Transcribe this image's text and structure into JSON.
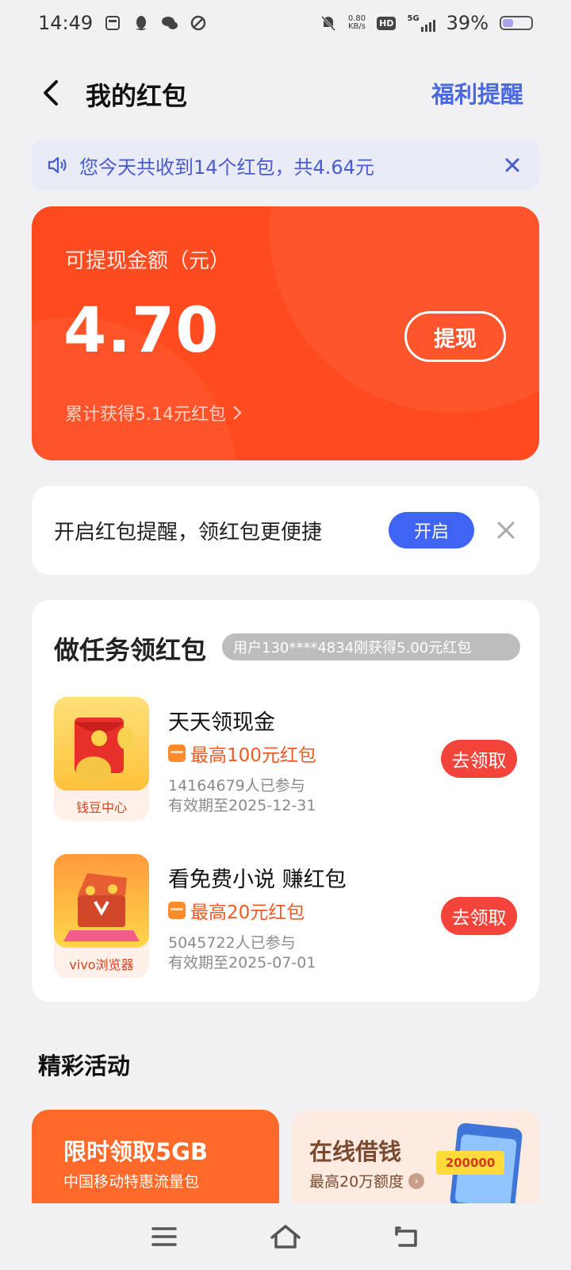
{
  "status_bar": {
    "time": "14:49",
    "speed_value": "0.80",
    "speed_unit": "KB/s",
    "hd_label": "HD",
    "network_label": "5G",
    "battery_text": "39%",
    "battery_level": 0.39
  },
  "header": {
    "title": "我的红包",
    "right_link": "福利提醒"
  },
  "notice": {
    "text": "您今天共收到14个红包，共4.64元"
  },
  "balance": {
    "label": "可提现金额（元）",
    "amount": "4.70",
    "withdraw_label": "提现",
    "total_text": "累计获得5.14元红包"
  },
  "reminder": {
    "text": "开启红包提醒，领红包更便捷",
    "button_label": "开启"
  },
  "tasks": {
    "title": "做任务领红包",
    "marquee": "用户130****4834刚获得5.00元红包",
    "items": [
      {
        "thumb_label": "钱豆中心",
        "name": "天天领现金",
        "reward": "最高100元红包",
        "participants": "14164679人已参与",
        "validity": "有效期至2025-12-31",
        "button_label": "去领取"
      },
      {
        "thumb_label": "vivo浏览器",
        "name": "看免费小说 赚红包",
        "reward": "最高20元红包",
        "participants": "5045722人已参与",
        "validity": "有效期至2025-07-01",
        "button_label": "去领取"
      }
    ]
  },
  "activities": {
    "title": "精彩活动",
    "cards": [
      {
        "title": "限时领取5GB",
        "subtitle": "中国移动特惠流量包"
      },
      {
        "title": "在线借钱",
        "subtitle": "最高20万额度",
        "art_text": "200000"
      }
    ]
  },
  "colors": {
    "accent_blue": "#4a68e0",
    "card_red": "#ff4b1f",
    "button_red": "#f2443a",
    "enable_blue": "#3f63f3"
  }
}
